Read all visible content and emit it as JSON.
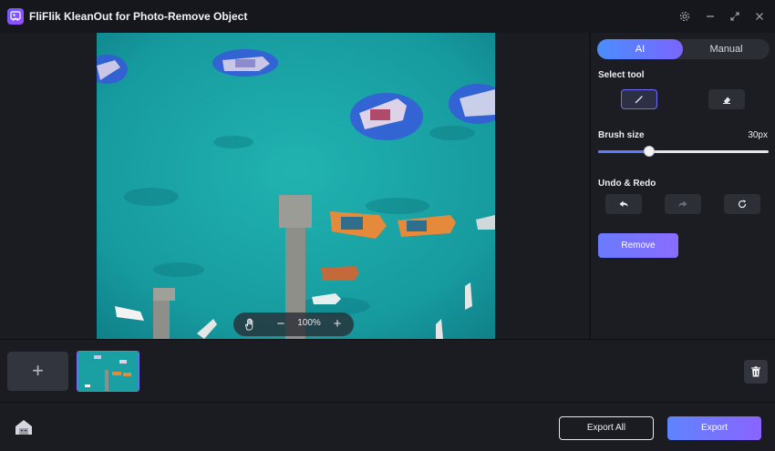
{
  "app": {
    "title": "FliFlik KleanOut for Photo-Remove Object"
  },
  "window_controls": {
    "icons": [
      "gear-icon",
      "minimize-icon",
      "maximize-icon",
      "close-icon"
    ]
  },
  "canvas": {
    "zoom_level": "100%"
  },
  "panel": {
    "mode_ai_label": "AI",
    "mode_manual_label": "Manual",
    "active_mode": "AI",
    "select_tool_label": "Select tool",
    "tools": [
      "brush-icon",
      "eraser-icon"
    ],
    "active_tool": "brush",
    "brush_size_label": "Brush size",
    "brush_size_value": "30px",
    "brush_size_fraction": 0.3,
    "undo_redo_label": "Undo & Redo",
    "remove_label": "Remove"
  },
  "thumb_strip": {
    "add_label": "+"
  },
  "footer": {
    "export_all_label": "Export All",
    "export_label": "Export"
  },
  "colors": {
    "accent": "#6c6cff",
    "water": "#1aa6a6",
    "selection_overlay": "#3a54e0"
  }
}
